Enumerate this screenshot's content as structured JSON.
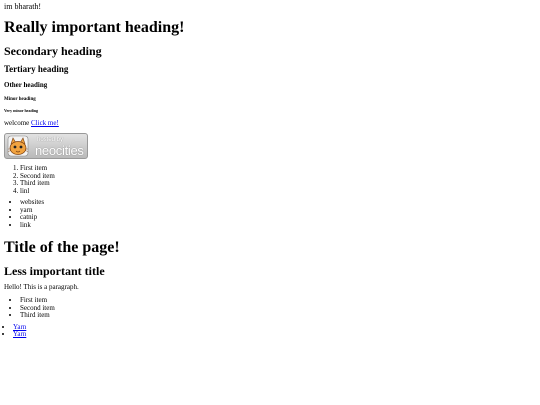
{
  "intro": "im bharath!",
  "headings": {
    "h1": "Really important heading!",
    "h2": "Secondary heading",
    "h3": "Tertiary heading",
    "h4": "Other heading",
    "h5": "Minor heading",
    "h6": "Very minor heading"
  },
  "welcome": {
    "text": "welcome",
    "link": "Click me!"
  },
  "badge": {
    "hosted": "hosted by",
    "brand": "neocities",
    "icon": "neocities-cat-icon"
  },
  "ordered_list": [
    "First item",
    "Second item",
    "Third item",
    "linl"
  ],
  "unordered_list": [
    "websites",
    "yarn",
    "catnip",
    "link"
  ],
  "section2": {
    "title": "Title of the page!",
    "subtitle": "Less important title",
    "paragraph": "Hello! This is a paragraph.",
    "items": [
      "First item",
      "Second item",
      "Third item"
    ]
  },
  "links": [
    "Yarn",
    "Yarn"
  ]
}
